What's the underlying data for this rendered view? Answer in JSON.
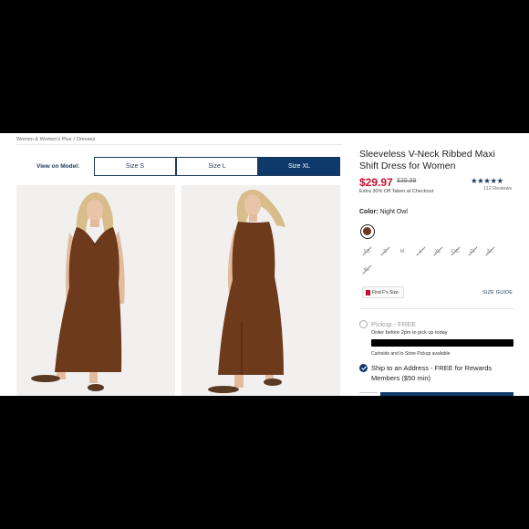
{
  "breadcrumb": [
    "Women & Women's Plus",
    "Dresses"
  ],
  "breadcrumb_sep": "/",
  "view_on_model": {
    "label": "View on Model:",
    "options": [
      "Size S",
      "Size L",
      "Size XL"
    ],
    "selected": "Size XL"
  },
  "product": {
    "title": "Sleeveless V-Neck Ribbed Maxi Shift Dress for Women",
    "rating_stars": "★★★★★",
    "rating": 4.5,
    "reviews": "112 Reviews",
    "price": "$29.97",
    "original_price": "$39.99",
    "promo": "Extra 30% Off Taken at Checkout",
    "color_label": "Color:",
    "color_name": "Night Owl",
    "swatch_color": "#6e3a1c",
    "sizes": [
      "XS",
      "S",
      "M",
      "L",
      "XL",
      "XXL",
      "2X",
      "3X",
      "4X"
    ],
    "available_sizes": [
      "M"
    ],
    "find_size": "Find F's Size",
    "size_guide": "SIZE GUIDE"
  },
  "fulfillment": {
    "pickup_title": "Pickup - FREE",
    "pickup_sub": "Order before 2pm to pick up today",
    "pickup_store": "Curbside and In-Store Pickup available",
    "ship_text": "Ship to an Address - FREE for Rewards Members ($50 min)"
  },
  "colors": {
    "navy": "#0d3a6b",
    "price_red": "#c8102e",
    "dress_brown": "#6e3a1c"
  }
}
